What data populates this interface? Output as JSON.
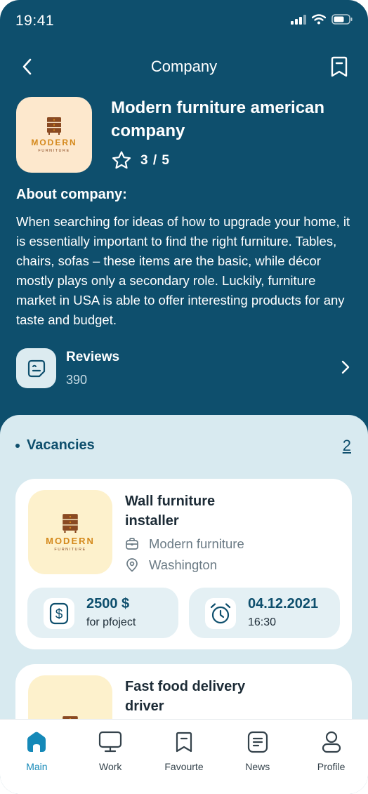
{
  "status_bar": {
    "time": "19:41"
  },
  "nav": {
    "title": "Company"
  },
  "company": {
    "logo": {
      "wordmark": "MODERN",
      "sub": "FURNITURE"
    },
    "name": "Modern furniture american company",
    "rating": "3 / 5",
    "about_title": "About company:",
    "about_text": "When searching for ideas of how to upgrade your home, it is essentially important to find the right furniture. Tables, chairs, sofas – these items are the basic, while décor mostly plays only a secondary role. Luckily, furniture market in USA is able to offer interesting products for any taste and budget."
  },
  "reviews": {
    "label": "Reviews",
    "count": "390"
  },
  "vacancies": {
    "title": "Vacancies",
    "count": "2",
    "items": [
      {
        "logo": {
          "wordmark": "MODERN",
          "sub": "FURNITURE"
        },
        "title": "Wall furniture installer",
        "company": "Modern furniture",
        "location": "Washington",
        "salary": "2500 $",
        "salary_note": "for pfoject",
        "date": "04.12.2021",
        "time": "16:30"
      },
      {
        "title": "Fast food delivery driver"
      }
    ]
  },
  "tabs": [
    {
      "label": "Main",
      "icon": "home-icon",
      "active": true
    },
    {
      "label": "Work",
      "icon": "monitor-icon",
      "active": false
    },
    {
      "label": "Favourte",
      "icon": "bookmark-icon",
      "active": false
    },
    {
      "label": "News",
      "icon": "news-icon",
      "active": false
    },
    {
      "label": "Profile",
      "icon": "profile-icon",
      "active": false
    }
  ],
  "colors": {
    "primary": "#0e4f6d",
    "sheet": "#d8eaf0",
    "accent": "#1589b8",
    "logo_bg": "#fde8cd"
  }
}
